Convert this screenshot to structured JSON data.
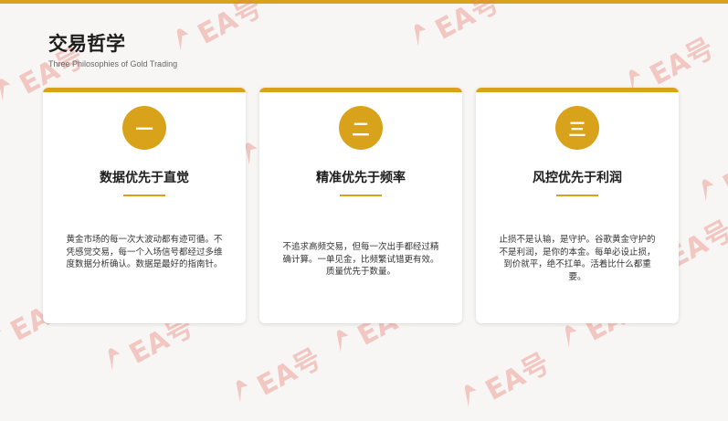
{
  "header": {
    "title": "交易哲学",
    "subtitle": "Three Philosophies of Gold Trading"
  },
  "watermark": {
    "text": "EA号"
  },
  "colors": {
    "accent": "#d9a21b",
    "background": "#f7f6f4",
    "watermark": "#e9786e"
  },
  "cards": [
    {
      "badge": "一",
      "title": "数据优先于直觉",
      "description": "黄金市场的每一次大波动都有迹可循。不凭感觉交易，每一个入场信号都经过多维度数据分析确认。数据是最好的指南针。"
    },
    {
      "badge": "二",
      "title": "精准优先于频率",
      "description": "不追求高频交易，但每一次出手都经过精确计算。一单见金，比频繁试错更有效。质量优先于数量。"
    },
    {
      "badge": "三",
      "title": "风控优先于利润",
      "description": "止损不是认输，是守护。谷歌黄金守护的不是利润，是你的本金。每单必设止损，到价就平，绝不扛单。活着比什么都重要。"
    }
  ]
}
